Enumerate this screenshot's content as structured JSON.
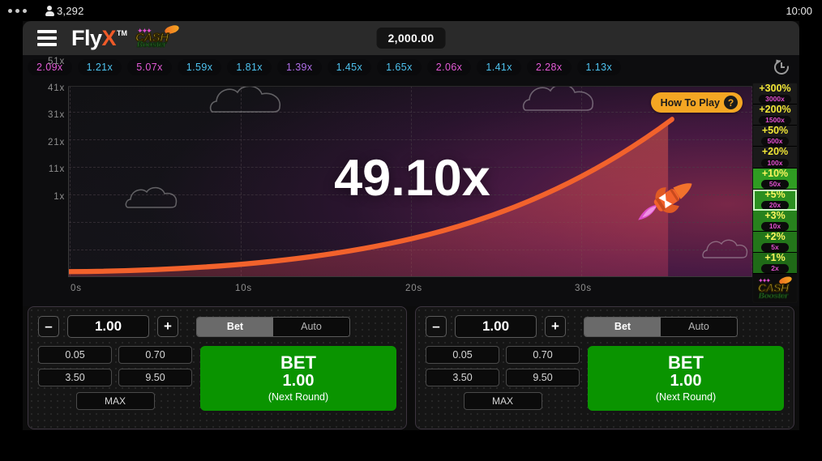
{
  "statusbar": {
    "viewers": "3,292",
    "time": "10:00",
    "person_icon": "person-icon",
    "menu_dots_icon": "more-dots-icon"
  },
  "header": {
    "menu_icon": "hamburger-menu-icon",
    "brand_fly": "Fly",
    "brand_x": "X",
    "brand_tm": "TM",
    "cash_badge_top": "CASH",
    "cash_badge_bottom": "Booster",
    "balance": "2,000.00"
  },
  "history": {
    "history_icon": "history-clock-icon",
    "chips": [
      {
        "label": "2.09x",
        "tier": "high"
      },
      {
        "label": "1.21x",
        "tier": "low"
      },
      {
        "label": "5.07x",
        "tier": "high"
      },
      {
        "label": "1.59x",
        "tier": "low"
      },
      {
        "label": "1.81x",
        "tier": "low"
      },
      {
        "label": "1.39x",
        "tier": "mid"
      },
      {
        "label": "1.45x",
        "tier": "low"
      },
      {
        "label": "1.65x",
        "tier": "low"
      },
      {
        "label": "2.06x",
        "tier": "high"
      },
      {
        "label": "1.41x",
        "tier": "low"
      },
      {
        "label": "2.28x",
        "tier": "high"
      },
      {
        "label": "1.13x",
        "tier": "low"
      }
    ]
  },
  "game": {
    "current_multiplier": "49.10x",
    "how_to_play": "How To Play",
    "how_to_play_icon": "question-mark-icon",
    "rocket_icon": "rocket-icon",
    "cloud_icon": "cloud-icon",
    "accent_curve_color": "#f2622c",
    "accent_brand_color": "#f05a28"
  },
  "chart_data": {
    "type": "line",
    "title": "",
    "xlabel": "",
    "ylabel": "",
    "x_ticks": [
      "0s",
      "10s",
      "20s",
      "30s"
    ],
    "x_tick_values": [
      0,
      10,
      20,
      30
    ],
    "y_ticks": [
      "1x",
      "11x",
      "21x",
      "31x",
      "41x",
      "51x"
    ],
    "y_tick_values": [
      1,
      11,
      21,
      31,
      41,
      51
    ],
    "xlim": [
      0,
      40
    ],
    "ylim": [
      1,
      56
    ],
    "grid": true,
    "legend": "none",
    "series": [
      {
        "name": "multiplier",
        "color": "#f2622c",
        "x": [
          0,
          2,
          4,
          6,
          8,
          10,
          12,
          14,
          16,
          18,
          20,
          22,
          24,
          26,
          28,
          30,
          32
        ],
        "values": [
          1.0,
          1.3,
          1.7,
          2.2,
          3.0,
          3.9,
          5.2,
          6.9,
          9.1,
          12.0,
          15.5,
          19.5,
          24.0,
          29.5,
          35.5,
          42.0,
          49.1
        ]
      }
    ],
    "annotations": [
      {
        "text": "49.10x",
        "type": "current-multiplier"
      }
    ]
  },
  "ladder": {
    "rows": [
      {
        "pct": "+300%",
        "mult": "3000x",
        "style": "dark",
        "selected": false
      },
      {
        "pct": "+200%",
        "mult": "1500x",
        "style": "dark",
        "selected": false
      },
      {
        "pct": "+50%",
        "mult": "500x",
        "style": "dark",
        "selected": false
      },
      {
        "pct": "+20%",
        "mult": "100x",
        "style": "dark",
        "selected": false
      },
      {
        "pct": "+10%",
        "mult": "50x",
        "style": "g1",
        "selected": false
      },
      {
        "pct": "+5%",
        "mult": "20x",
        "style": "g2",
        "selected": true
      },
      {
        "pct": "+3%",
        "mult": "10x",
        "style": "g3",
        "selected": false
      },
      {
        "pct": "+2%",
        "mult": "5x",
        "style": "g4",
        "selected": false
      },
      {
        "pct": "+1%",
        "mult": "2x",
        "style": "g5",
        "selected": false
      }
    ],
    "footer_top": "CASH",
    "footer_bottom": "Booster"
  },
  "bet_panels": [
    {
      "amount": "1.00",
      "minus": "–",
      "plus": "+",
      "tab_bet": "Bet",
      "tab_auto": "Auto",
      "quick": [
        "0.05",
        "0.70",
        "3.50",
        "9.50"
      ],
      "max": "MAX",
      "button_title": "BET",
      "button_amount": "1.00",
      "button_note": "(Next Round)"
    },
    {
      "amount": "1.00",
      "minus": "–",
      "plus": "+",
      "tab_bet": "Bet",
      "tab_auto": "Auto",
      "quick": [
        "0.05",
        "0.70",
        "3.50",
        "9.50"
      ],
      "max": "MAX",
      "button_title": "BET",
      "button_amount": "1.00",
      "button_note": "(Next Round)"
    }
  ]
}
